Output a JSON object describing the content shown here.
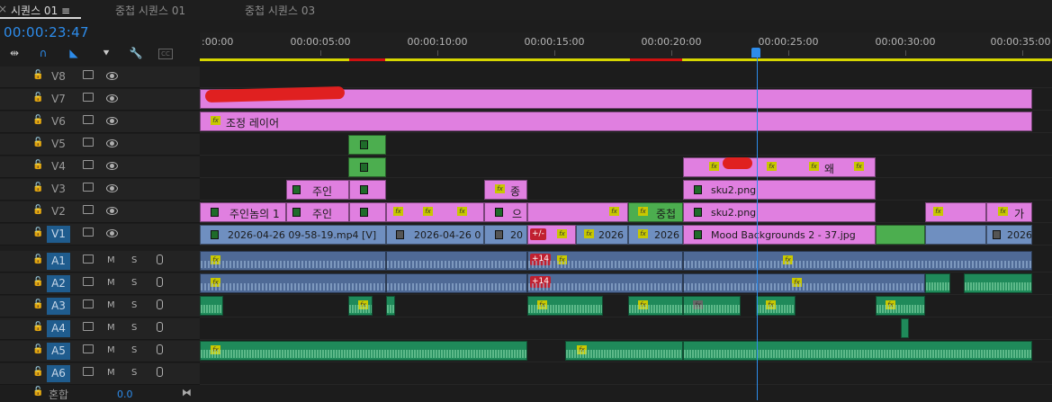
{
  "tabs": [
    {
      "label": "시퀀스 01 ≡",
      "active": true
    },
    {
      "label": "중첩 시퀀스 01",
      "active": false
    },
    {
      "label": "중첩 시퀀스 03",
      "active": false
    }
  ],
  "timecode": "00:00:23:47",
  "close_symbol": "×",
  "ruler": {
    "labels": [
      ":00:00",
      "00:00:05:00",
      "00:00:10:00",
      "00:00:15:00",
      "00:00:20:00",
      "00:00:25:00",
      "00:00:30:00",
      "00:00:35:00"
    ]
  },
  "tools": [
    "ripple-insert-icon",
    "snap-magnet-icon",
    "linked-selection-icon",
    "marker-icon",
    "wrench-icon",
    "captions-icon"
  ],
  "video_tracks": [
    {
      "name": "V8"
    },
    {
      "name": "V7"
    },
    {
      "name": "V6"
    },
    {
      "name": "V5"
    },
    {
      "name": "V4"
    },
    {
      "name": "V3"
    },
    {
      "name": "V2"
    },
    {
      "name": "V1",
      "targeted": true
    }
  ],
  "audio_tracks": [
    {
      "name": "A1"
    },
    {
      "name": "A2"
    },
    {
      "name": "A3"
    },
    {
      "name": "A4"
    },
    {
      "name": "A5"
    },
    {
      "name": "A6"
    }
  ],
  "mute_label": "M",
  "solo_label": "S",
  "mix": {
    "label": "혼합",
    "value": "0.0"
  },
  "clips": {
    "v6_adjustment": "조정 레이어",
    "v4_label": "왜",
    "v3_a": "주인",
    "v3_b": "종",
    "v3_sku": "sku2.png",
    "v2_a": "주인놈의 1",
    "v2_b": "주인",
    "v2_c": "으",
    "v2_d": "중첩",
    "v2_sku": "sku2.png",
    "v2_end": "가",
    "v1_a": "2026-04-26 09-58-19.mp4 [V]",
    "v1_b": "2026-04-26 0",
    "v1_c": "20",
    "v1_d": "2026",
    "v1_e": "2026",
    "v1_mood": "Mood Backgrounds 2 - 37.jpg",
    "v1_end": "2026",
    "badge_plusminus": "+/-",
    "badge_a1": "+14",
    "badge_a2": "+14"
  },
  "colors": {
    "accent": "#2d8ceb",
    "adjustment_clip": "#e07fe0",
    "video_clip_green": "#4cae4f",
    "video_clip_blue": "#6f8fc0",
    "audio_clip_blue": "#4f6a96",
    "audio_clip_green": "#1f8a5a",
    "work_area": "#d6d600"
  }
}
